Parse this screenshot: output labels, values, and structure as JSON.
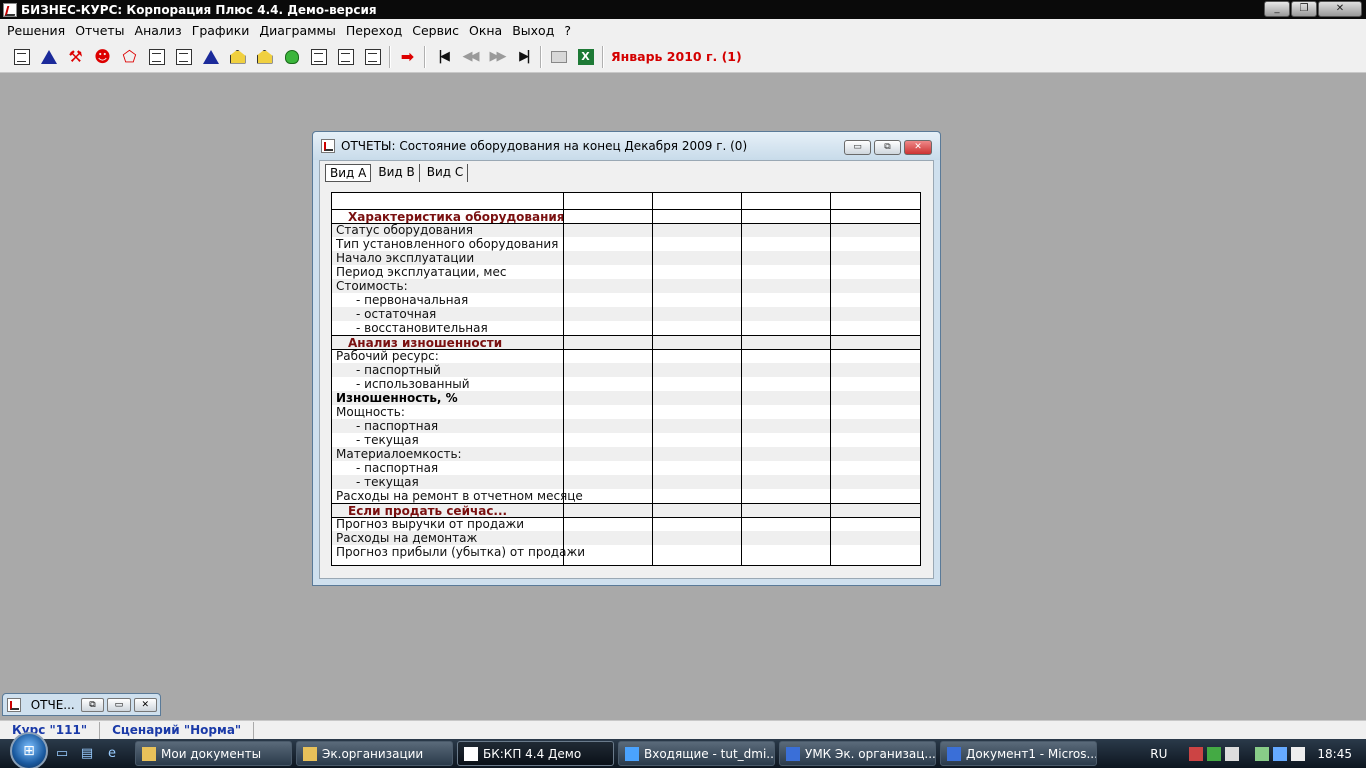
{
  "app": {
    "title": "БИЗНЕС-КУРС: Корпорация Плюс 4.4. Демо-версия",
    "controls": {
      "minimize": "_",
      "restore": "❐",
      "close": "✕"
    }
  },
  "menu": [
    "Решения",
    "Отчеты",
    "Анализ",
    "Графики",
    "Диаграммы",
    "Переход",
    "Сервис",
    "Окна",
    "Выход",
    "?"
  ],
  "toolbar": {
    "period": "Январь 2010 г. (1)",
    "excel_label": "X",
    "arrow_glyph": "➡",
    "first_glyph": "|◀",
    "prev_glyph": "◀◀",
    "next_glyph": "▶▶",
    "last_glyph": "▶|"
  },
  "report_window": {
    "title": "ОТЧЕТЫ: Состояние оборудования на конец Декабря 2009 г. (0)",
    "tabs": [
      "Вид A",
      "Вид B",
      "Вид C"
    ],
    "controls": {
      "minimize": "▭",
      "restore": "⧉",
      "close": "✕"
    },
    "rows": [
      {
        "label": "Характеристика оборудования",
        "style": "section"
      },
      {
        "label": "Статус оборудования",
        "style": "normal"
      },
      {
        "label": "Тип установленного оборудования",
        "style": "normal"
      },
      {
        "label": "Начало эксплуатации",
        "style": "normal"
      },
      {
        "label": "Период эксплуатации, мес",
        "style": "normal"
      },
      {
        "label": "Стоимость:",
        "style": "normal"
      },
      {
        "label": "- первоначальная",
        "style": "indent"
      },
      {
        "label": "- остаточная",
        "style": "indent"
      },
      {
        "label": "- восстановительная",
        "style": "indent"
      },
      {
        "label": "Анализ изношенности",
        "style": "section"
      },
      {
        "label": "Рабочий ресурс:",
        "style": "normal"
      },
      {
        "label": "- паспортный",
        "style": "indent"
      },
      {
        "label": "- использованный",
        "style": "indent"
      },
      {
        "label": "Изношенность, %",
        "style": "bold"
      },
      {
        "label": "Мощность:",
        "style": "normal"
      },
      {
        "label": "- паспортная",
        "style": "indent"
      },
      {
        "label": "- текущая",
        "style": "indent"
      },
      {
        "label": "Материалоемкость:",
        "style": "normal"
      },
      {
        "label": "- паспортная",
        "style": "indent"
      },
      {
        "label": "- текущая",
        "style": "indent"
      },
      {
        "label": "Расходы на ремонт в отчетном месяце",
        "style": "normal"
      },
      {
        "label": "Если продать сейчас...",
        "style": "section"
      },
      {
        "label": "Прогноз выручки от продажи",
        "style": "normal"
      },
      {
        "label": "Расходы на демонтаж",
        "style": "normal"
      },
      {
        "label": "Прогноз прибыли (убытка) от продажи",
        "style": "normal"
      }
    ]
  },
  "minimized_window": {
    "title": "ОТЧЕ...",
    "controls": {
      "restore": "⧉",
      "maximize": "▭",
      "close": "✕"
    }
  },
  "status": {
    "course": "Курс \"111\"",
    "scenario": "Сценарий \"Норма\""
  },
  "taskbar": {
    "start_glyph": "⊞",
    "items": [
      {
        "label": "Мои документы",
        "icon": "folder-icon",
        "active": false
      },
      {
        "label": "Эк.организации",
        "icon": "folder-icon",
        "active": false
      },
      {
        "label": "БК:КП 4.4 Демо",
        "icon": "app-icon",
        "active": true
      },
      {
        "label": "Входящие - tut_dmi...",
        "icon": "ie-icon",
        "active": false
      },
      {
        "label": "УМК Эк. организац...",
        "icon": "word-icon",
        "active": false
      },
      {
        "label": "Документ1 - Micros...",
        "icon": "word-icon",
        "active": false
      }
    ],
    "lang": "RU",
    "clock": "18:45"
  }
}
